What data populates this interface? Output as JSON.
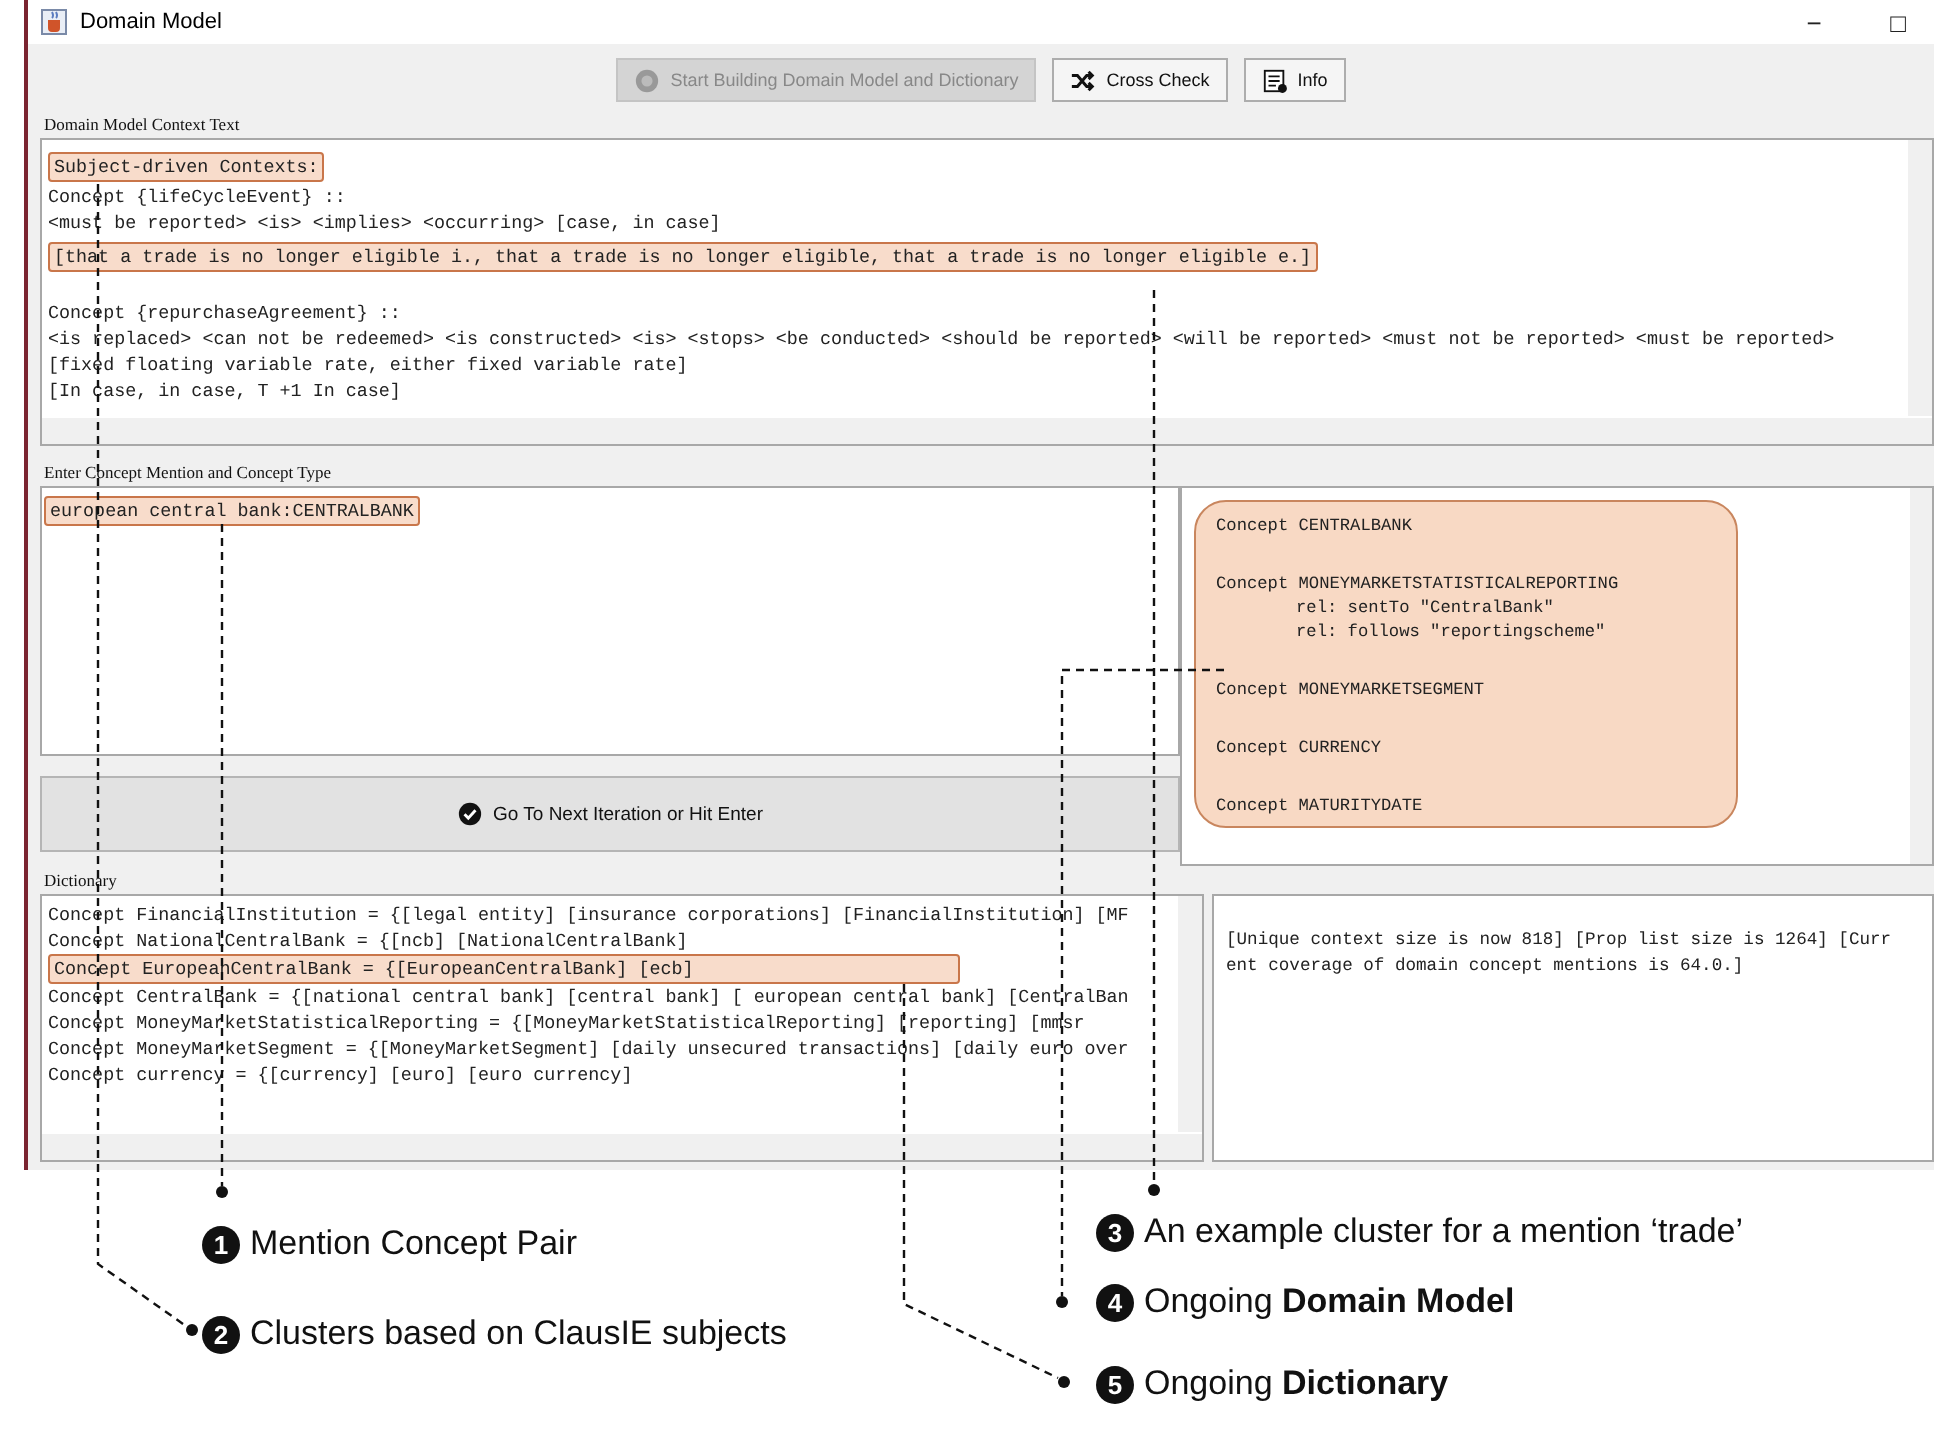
{
  "window": {
    "title": "Domain Model",
    "controls": [
      "−",
      "□"
    ]
  },
  "toolbar": [
    {
      "label": "Start Building Domain Model and Dictionary",
      "disabled": true
    },
    {
      "label": "Cross Check",
      "disabled": false
    },
    {
      "label": "Info",
      "disabled": false
    }
  ],
  "context": {
    "label": "Domain Model Context Text",
    "blocks": [
      [
        {
          "text": "Subject-driven Contexts:",
          "highlighted": true
        },
        {
          "text": "Concept {lifeCycleEvent} ::",
          "highlighted": false
        },
        {
          "text": "<must be reported> <is> <implies> <occurring> [case, in case]",
          "highlighted": false
        },
        {
          "text": "[that a trade is no longer eligible i., that a trade is no longer eligible, that a trade is no longer eligible e.]",
          "highlighted": true
        }
      ],
      [
        {
          "text": "Concept {repurchaseAgreement} ::",
          "highlighted": false
        },
        {
          "text": "<is replaced> <can not be redeemed> <is constructed> <is> <stops> <be conducted> <should be reported> <will be reported> <must not be reported> <must be reported>",
          "highlighted": false
        },
        {
          "text": "[fixed floating variable rate, either fixed variable rate]",
          "highlighted": false
        },
        {
          "text": "[In case, in case, T +1 In case]",
          "highlighted": false
        }
      ]
    ]
  },
  "mention": {
    "label": "Enter Concept Mention and Concept Type",
    "value": "european central bank:CENTRALBANK",
    "highlighted": true,
    "button": "Go To Next Iteration or Hit Enter"
  },
  "domain_model": [
    {
      "name": "Concept CENTRALBANK"
    },
    {
      "name": "Concept MONEYMARKETSTATISTICALREPORTING",
      "relations": [
        "rel: sentTo \"CentralBank\"",
        "rel: follows \"reportingscheme\""
      ]
    },
    {
      "name": "Concept MONEYMARKETSEGMENT"
    },
    {
      "name": "Concept CURRENCY"
    },
    {
      "name": "Concept MATURITYDATE"
    }
  ],
  "dictionary": {
    "label": "Dictionary",
    "lines": [
      {
        "text": "Concept FinancialInstitution = {[legal entity] [insurance corporations] [FinancialInstitution] [MF",
        "highlighted": false
      },
      {
        "text": "Concept NationalCentralBank = {[ncb] [NationalCentralBank]",
        "highlighted": false
      },
      {
        "text": "Concept EuropeanCentralBank = {[EuropeanCentralBank] [ecb]",
        "highlighted": true
      },
      {
        "text": "Concept CentralBank = {[national central bank] [central bank] [ european central bank] [CentralBan",
        "highlighted": false
      },
      {
        "text": "Concept MoneyMarketStatisticalReporting = {[MoneyMarketStatisticalReporting] [reporting] [mmsr",
        "highlighted": false
      },
      {
        "text": "Concept MoneyMarketSegment = {[MoneyMarketSegment] [daily unsecured transactions] [daily euro over",
        "highlighted": false
      },
      {
        "text": "Concept currency = {[currency] [euro] [euro currency]",
        "highlighted": false
      }
    ],
    "status": [
      "[Unique context size is now 818] [Prop list size is 1264] [Curr",
      "ent coverage of domain concept mentions is 64.0.]"
    ]
  },
  "annotations": [
    {
      "number": "1",
      "text": "Mention Concept Pair"
    },
    {
      "number": "2",
      "text": "Clusters based on ClausIE subjects"
    },
    {
      "number": "3",
      "text": "An example cluster for a mention ‘trade’"
    },
    {
      "number": "4",
      "text": "Ongoing **Domain Model**"
    },
    {
      "number": "5",
      "text": "Ongoing **Dictionary**"
    }
  ]
}
